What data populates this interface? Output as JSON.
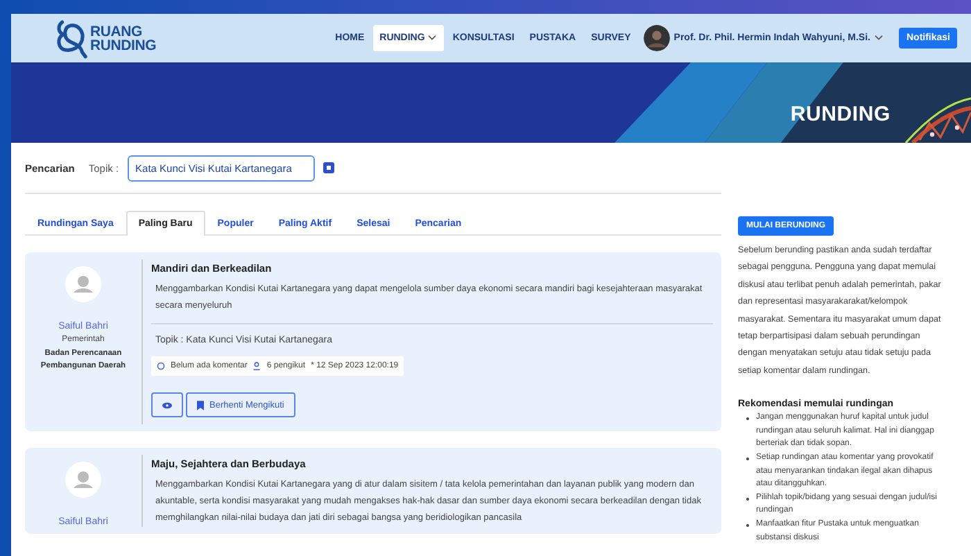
{
  "header": {
    "logo_lines": [
      "RUANG",
      "RUNDING"
    ],
    "nav": [
      {
        "label": "HOME",
        "selected": false,
        "dropdown": false
      },
      {
        "label": "RUNDING",
        "selected": true,
        "dropdown": true
      },
      {
        "label": "KONSULTASI",
        "selected": false,
        "dropdown": false
      },
      {
        "label": "PUSTAKA",
        "selected": false,
        "dropdown": false
      },
      {
        "label": "SURVEY",
        "selected": false,
        "dropdown": false
      }
    ],
    "user": "Prof. Dr. Phil. Hermin Indah Wahyuni, M.Si.",
    "notify_button": "Notifikasi"
  },
  "banner": {
    "title": "RUNDING"
  },
  "search": {
    "label": "Pencarian",
    "topic_label": "Topik :",
    "topic_value": "Kata Kunci Visi Kutai Kartanegara"
  },
  "tabs": [
    {
      "label": "Rundingan Saya",
      "selected": false
    },
    {
      "label": "Paling Baru",
      "selected": true
    },
    {
      "label": "Populer",
      "selected": false
    },
    {
      "label": "Paling Aktif",
      "selected": false
    },
    {
      "label": "Selesai",
      "selected": false
    },
    {
      "label": "Pencarian",
      "selected": false
    }
  ],
  "posts": [
    {
      "author": "Saiful Bahri",
      "role": "Pemerintah",
      "org": "Badan Perencanaan Pembangunan Daerah",
      "title": "Mandiri dan Berkeadilan",
      "body": "Menggambarkan Kondisi Kutai Kartanegara yang dapat mengelola sumber daya ekonomi secara mandiri bagi kesejahteraan masyarakat secara menyeluruh",
      "topic": "Topik : Kata Kunci Visi Kutai Kartanegara",
      "comments": "Belum ada komentar",
      "followers": "6 pengikut",
      "date": "* 12 Sep 2023 12:00:19",
      "unfollow": "Berhenti Mengikuti"
    },
    {
      "author": "Saiful Bahri",
      "title": "Maju, Sejahtera dan Berbudaya",
      "body": "Menggambarkan Kondisi Kutai Kartanegara yang di atur dalam sisitem / tata kelola pemerintahan dan layanan publik yang modern dan akuntable, serta kondisi masyarakat yang mudah mengakses hak-hak dasar dan sumber daya ekonomi secara berkeadilan dengan tidak memghilangkan nilai-nilai budaya dan jati diri sebagai bangsa yang beridiologikan pancasila"
    }
  ],
  "sidebar": {
    "button": "MULAI BERUNDING",
    "intro": "Sebelum berunding pastikan anda sudah terdaftar sebagai pengguna. Pengguna yang dapat memulai diskusi atau terlibat penuh adalah pemerintah, pakar dan representasi masyarakarakat/kelompok masyarakat. Sementara itu masyarakat umum dapat tetap berpartisipasi dalam sebuah perundingan dengan menyatakan setuju atau tidak setuju pada setiap komentar dalam rundingan.",
    "rec_title": "Rekomendasi memulai rundingan",
    "rec_items": [
      "Jangan menggunakan huruf kapital untuk judul rundingan atau seluruh kalimat. Hal ini dianggap berteriak dan tidak sopan.",
      "Setiap rundingan atau komentar yang provokatif atau menyarankan tindakan ilegal akan dihapus atau ditangguhkan.",
      "Pilihlah topik/bidang yang sesuai dengan judul/isi rundingan",
      "Manfaatkan fitur Pustaka untuk menguatkan substansi diskusi"
    ]
  }
}
